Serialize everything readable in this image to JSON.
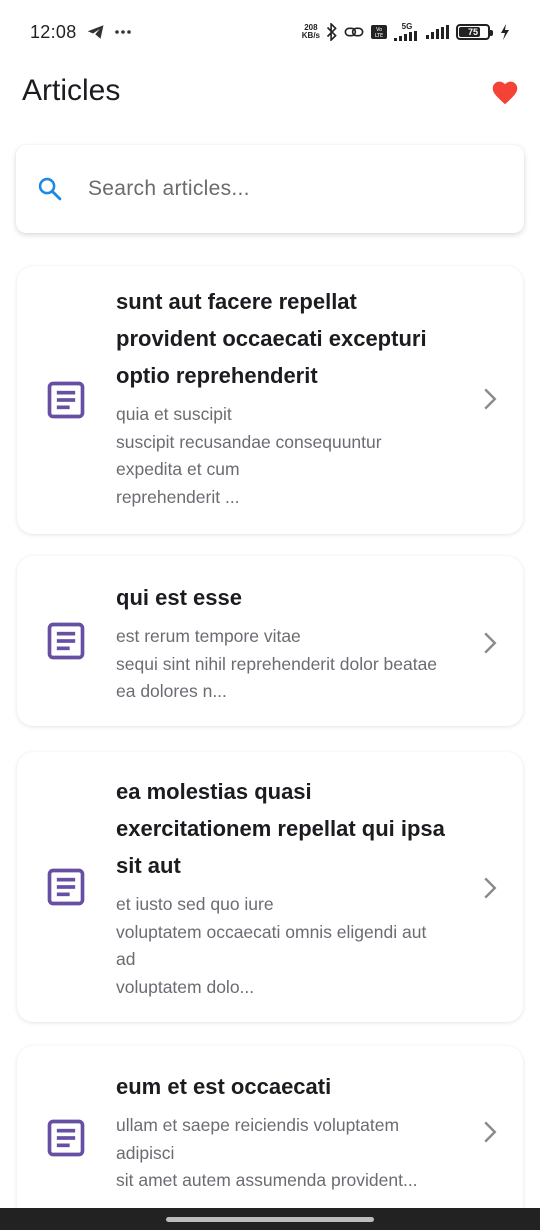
{
  "status_bar": {
    "time": "12:08",
    "net_speed_value": "208",
    "net_speed_unit": "KB/s",
    "battery": "75",
    "network": "5G",
    "volte": "Vo LTE",
    "icons": [
      "telegram-icon",
      "more-dots-icon",
      "bluetooth-icon",
      "link-icon",
      "volte-icon",
      "signal-icon",
      "battery-icon",
      "charging-icon"
    ]
  },
  "app_bar": {
    "title": "Articles",
    "favorite_icon": "heart-icon",
    "favorite_color": "#f44336"
  },
  "search": {
    "placeholder": "Search articles...",
    "value": "",
    "icon": "search-icon",
    "icon_color": "#1e88e5"
  },
  "articles": [
    {
      "title": "sunt aut facere repellat\nprovident occaecati excepturi\noptio reprehenderit",
      "excerpt": "quia et suscipit\nsuscipit recusandae consequuntur\nexpedita et cum\nreprehenderit ..."
    },
    {
      "title": "qui est esse",
      "excerpt": "est rerum tempore vitae\nsequi sint nihil reprehenderit dolor beatae\nea dolores n..."
    },
    {
      "title": "ea molestias quasi\nexercitationem repellat qui ipsa\nsit aut",
      "excerpt": "et iusto sed quo iure\nvoluptatem occaecati omnis eligendi aut\nad\nvoluptatem dolo..."
    },
    {
      "title": "eum et est occaecati",
      "excerpt": "ullam et saepe reiciendis voluptatem\nadipisci\nsit amet autem assumenda provident..."
    }
  ],
  "article_icon": "article-icon",
  "article_icon_color": "#6750a4",
  "chevron_icon": "chevron-right-icon"
}
